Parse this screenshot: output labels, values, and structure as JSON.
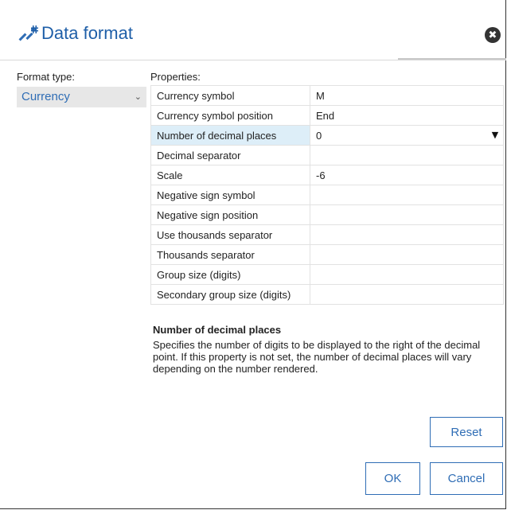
{
  "dialog": {
    "title": "Data format",
    "title_icon": "tools-icon",
    "close_icon": "close-icon",
    "close_glyph": "✖"
  },
  "format_type": {
    "label": "Format type:",
    "selected": "Currency",
    "chevron": "⌄"
  },
  "properties": {
    "label": "Properties:",
    "rows": [
      {
        "name": "Currency symbol",
        "value": "M"
      },
      {
        "name": "Currency symbol position",
        "value": "End"
      },
      {
        "name": "Number of decimal places",
        "value": "0"
      },
      {
        "name": "Decimal separator",
        "value": ""
      },
      {
        "name": "Scale",
        "value": "-6"
      },
      {
        "name": "Negative sign symbol",
        "value": ""
      },
      {
        "name": "Negative sign position",
        "value": ""
      },
      {
        "name": "Use thousands separator",
        "value": ""
      },
      {
        "name": "Thousands separator",
        "value": ""
      },
      {
        "name": "Group size (digits)",
        "value": ""
      },
      {
        "name": "Secondary group size (digits)",
        "value": ""
      }
    ],
    "selected_row": "Number of decimal places",
    "dropdown_arrow": "▼"
  },
  "description": {
    "title": "Number of decimal places",
    "text": "Specifies the number of digits to be displayed to the right of the decimal point. If this property is not set, the number of decimal places will vary depending on the number rendered."
  },
  "buttons": {
    "reset": "Reset",
    "ok": "OK",
    "cancel": "Cancel"
  },
  "colors": {
    "accent": "#2f6db5",
    "title": "#1f5fa8",
    "selected_row_bg": "#ddeef8"
  }
}
